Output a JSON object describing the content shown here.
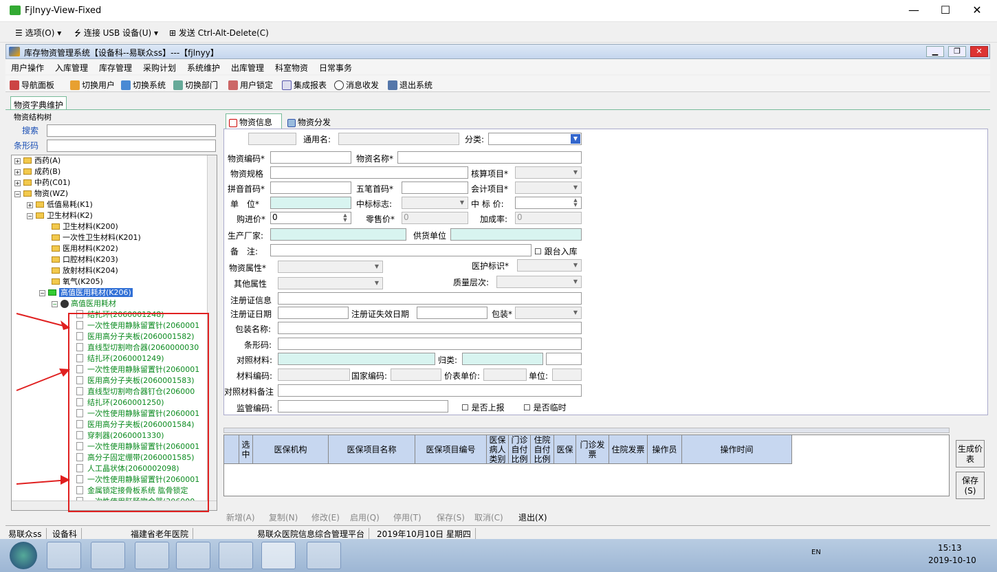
{
  "window": {
    "title": "Fjlnyy-View-Fixed",
    "min": "—",
    "max": "☐",
    "close": "✕"
  },
  "vm": {
    "options": "选项(O)",
    "usb": "连接 USB 设备(U)",
    "send": "发送 Ctrl-Alt-Delete(C)"
  },
  "app": {
    "title": "库存物资管理系统【设备科--易联众ss】---【fjlnyy】"
  },
  "menu": [
    "用户操作",
    "入库管理",
    "库存管理",
    "采购计划",
    "系统维护",
    "出库管理",
    "科室物资",
    "日常事务"
  ],
  "toolbar": [
    "导航面板",
    "切换用户",
    "切换系统",
    "切换部门",
    "用户锁定",
    "集成报表",
    "消息收发",
    "退出系统"
  ],
  "doc_tab": "物资字典维护",
  "left": {
    "group": "物资结构树",
    "search_label": "搜索",
    "barcode_label": "条形码",
    "tree": [
      "西药(A)",
      "成药(B)",
      "中药(C01)",
      "物资(WZ)",
      "低值易耗(K1)",
      "卫生材料(K2)",
      "卫生材料(K200)",
      "一次性卫生材料(K201)",
      "医用材料(K202)",
      "口腔材料(K203)",
      "放射材料(K204)",
      "氧气(K205)",
      "高值医用耗材(K206)",
      "高值医用耗材"
    ],
    "items": [
      "结扎环(2060001248)",
      "一次性使用静脉留置针(2060001",
      "医用高分子夹板(2060001582)",
      "直线型切割吻合器(2060000030",
      "结扎环(2060001249)",
      "一次性使用静脉留置针(2060001",
      "医用高分子夹板(2060001583)",
      "直线型切割吻合器钉仓(206000",
      "结扎环(2060001250)",
      "一次性使用静脉留置针(2060001",
      "医用高分子夹板(2060001584)",
      "穿刺器(2060001330)",
      "一次性使用静脉留置针(2060001",
      "高分子固定绷带(2060001585)",
      "人工晶状体(2060002098)",
      "一次性使用静脉留置针(2060001",
      "金属锁定接骨板系统 肱骨锁定",
      "一次性使用肛肠吻合器(206000"
    ]
  },
  "tabs": [
    "物资信息",
    "物资分发"
  ],
  "form": {
    "common_name": "通用名:",
    "category": "分类:",
    "code": "物资编码*",
    "name": "物资名称*",
    "spec": "物资规格",
    "acct_item": "核算项目*",
    "pinyin": "拼音首码*",
    "wubi": "五笔首码*",
    "acct_proj": "会计项目*",
    "unit": "单　位*",
    "bid_flag": "中标标志:",
    "bid_price": "中 标 价:",
    "buy_price": "购进价*",
    "buy_val": "0",
    "retail": "零售价*",
    "retail_val": "0",
    "markup": "加成率:",
    "markup_val": "0",
    "maker": "生产厂家:",
    "supplier": "供货单位",
    "remark": "备　注:",
    "follow": "跟台入库",
    "attr": "物资属性*",
    "med_flag": "医护标识*",
    "other_attr": "其他属性",
    "quality": "质量层次:",
    "reg_info": "注册证信息",
    "reg_date": "注册证日期",
    "reg_exp": "注册证失效日期",
    "pack": "包装*",
    "pack_name": "包装名称:",
    "barcode": "条形码:",
    "cmp_mat": "对照材料:",
    "cls": "归类:",
    "mat_code": "材料编码:",
    "nat_code": "国家编码:",
    "price_unit": "价表单价:",
    "unit2": "单位:",
    "cmp_remark": "对照材料备注",
    "sup_code": "监管编码:",
    "report": "是否上报",
    "temp": "是否临时"
  },
  "grid": {
    "cols": [
      "选中",
      "医保机构",
      "医保项目名称",
      "医保项目编号",
      "医保病人类别",
      "门诊自付比例",
      "住院自付比例",
      "医保",
      "门诊发票",
      "住院发票",
      "操作员",
      "操作时间"
    ]
  },
  "side": {
    "gen": "生成价表",
    "save": "保存(S)"
  },
  "actions": [
    "新增(A)",
    "复制(N)",
    "修改(E)",
    "启用(Q)",
    "停用(T)",
    "保存(S)",
    "取消(C)",
    "退出(X)"
  ],
  "status": [
    "易联众ss",
    "设备科",
    "福建省老年医院",
    "易联众医院信息综合管理平台",
    "2019年10月10日 星期四"
  ],
  "clock": {
    "time": "15:13",
    "date": "2019-10-10",
    "lang": "EN"
  }
}
